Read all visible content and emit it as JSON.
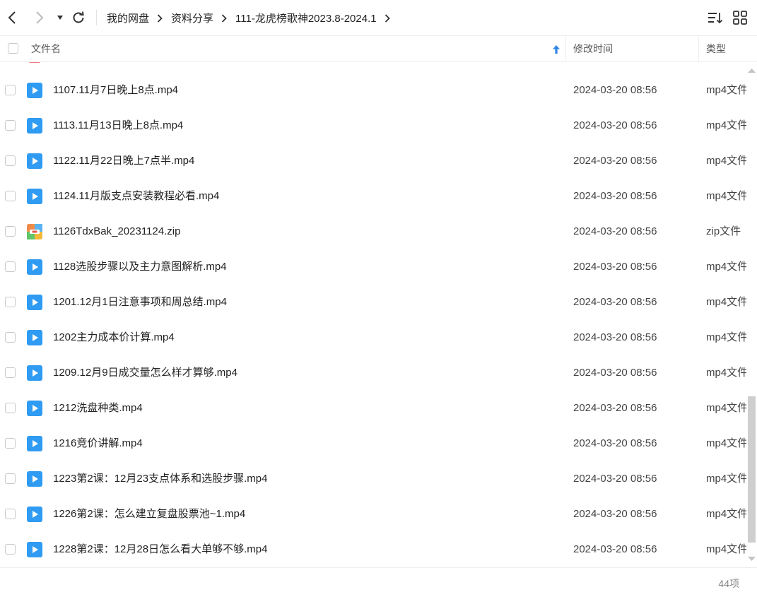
{
  "toolbar": {
    "breadcrumb": [
      "我的网盘",
      "资料分享",
      "111-龙虎榜歌神2023.8-2024.1"
    ]
  },
  "header": {
    "col_name": "文件名",
    "col_modified": "修改时间",
    "col_type": "类型"
  },
  "files": [
    {
      "name": "1107.11月7日晚上8点.mp4",
      "modified": "2024-03-20 08:56",
      "type": "mp4文件",
      "icon": "video-file-icon"
    },
    {
      "name": "1113.11月13日晚上8点.mp4",
      "modified": "2024-03-20 08:56",
      "type": "mp4文件",
      "icon": "video-file-icon"
    },
    {
      "name": "1122.11月22日晚上7点半.mp4",
      "modified": "2024-03-20 08:56",
      "type": "mp4文件",
      "icon": "video-file-icon"
    },
    {
      "name": "1124.11月版支点安装教程必看.mp4",
      "modified": "2024-03-20 08:56",
      "type": "mp4文件",
      "icon": "video-file-icon"
    },
    {
      "name": "1126TdxBak_20231124.zip",
      "modified": "2024-03-20 08:56",
      "type": "zip文件",
      "icon": "zip-file-icon"
    },
    {
      "name": "1128选股步骤以及主力意图解析.mp4",
      "modified": "2024-03-20 08:56",
      "type": "mp4文件",
      "icon": "video-file-icon"
    },
    {
      "name": "1201.12月1日注意事项和周总结.mp4",
      "modified": "2024-03-20 08:56",
      "type": "mp4文件",
      "icon": "video-file-icon"
    },
    {
      "name": "1202主力成本价计算.mp4",
      "modified": "2024-03-20 08:56",
      "type": "mp4文件",
      "icon": "video-file-icon"
    },
    {
      "name": "1209.12月9日成交量怎么样才算够.mp4",
      "modified": "2024-03-20 08:56",
      "type": "mp4文件",
      "icon": "video-file-icon"
    },
    {
      "name": "1212洗盘种类.mp4",
      "modified": "2024-03-20 08:56",
      "type": "mp4文件",
      "icon": "video-file-icon"
    },
    {
      "name": "1216竞价讲解.mp4",
      "modified": "2024-03-20 08:56",
      "type": "mp4文件",
      "icon": "video-file-icon"
    },
    {
      "name": "1223第2课：12月23支点体系和选股步骤.mp4",
      "modified": "2024-03-20 08:56",
      "type": "mp4文件",
      "icon": "video-file-icon"
    },
    {
      "name": "1226第2课：怎么建立复盘股票池~1.mp4",
      "modified": "2024-03-20 08:56",
      "type": "mp4文件",
      "icon": "video-file-icon"
    },
    {
      "name": "1228第2课：12月28日怎么看大单够不够.mp4",
      "modified": "2024-03-20 08:56",
      "type": "mp4文件",
      "icon": "video-file-icon"
    }
  ],
  "footer": {
    "count": "44项"
  },
  "colors": {
    "video_icon": "#2f9bf2",
    "sort_arrow": "#2f86e8"
  }
}
